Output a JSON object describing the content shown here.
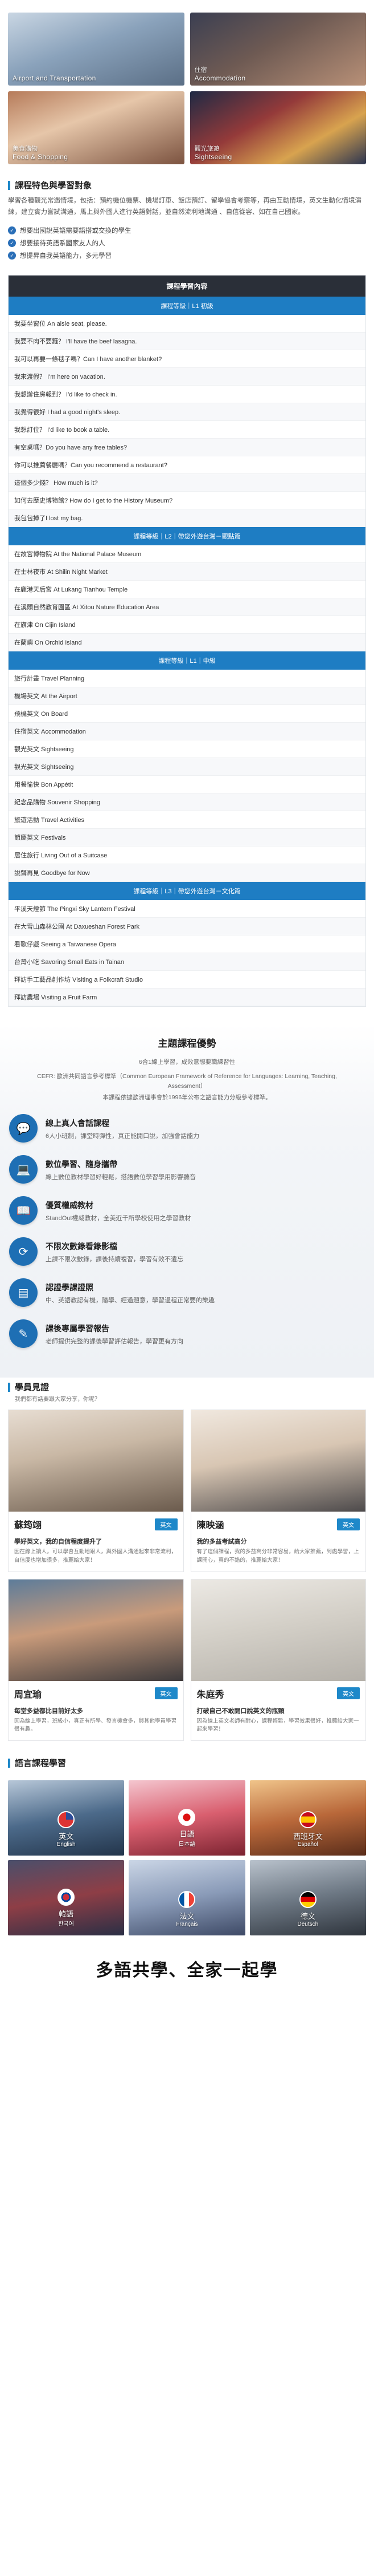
{
  "gallery": [
    {
      "zh": "",
      "en": "Airport and Transportation",
      "name": "airport"
    },
    {
      "zh": "住宿",
      "en": "Accommodation",
      "name": "accommodation"
    },
    {
      "zh": "美食購物",
      "en": "Food & Shopping",
      "name": "food"
    },
    {
      "zh": "觀光旅遊",
      "en": "Sightseeing",
      "name": "sightseeing"
    }
  ],
  "features": {
    "title": "課程特色與學習對象",
    "intro": "學習各種觀光常遇情境，包括：預約機位機票、機場訂車、飯店預訂、留學協會考察等，再由互動情境，英文生動化情境演練，建立實力嘗試溝通，馬上與外國人進行英語對話，並自然流利地溝通 、自信從容、如在自己國家。",
    "checks": [
      "想要出國說英語需要語搭或交換的學生",
      "想要接待英語系國家友人的人",
      "想提昇自我英語能力，多元學習"
    ]
  },
  "course": {
    "title": "課程學習內容",
    "levels": [
      {
        "label": "課程等級｜L1 初級",
        "items": [
          "我要坐窗位 An aisle seat, please.",
          "我要不肉不要麵？ I'll have the beef lasagna.",
          "我可以再要一條毯子嗎？Can I have another blanket?",
          "我來渡假？ I'm here on vacation.",
          "我想辦住房報到？ I'd like to check in.",
          "我覺得很好 I had a good night's sleep.",
          "我想訂位？ I'd like to book a table.",
          "有空桌嗎？Do you have any free tables?",
          "你可以推薦餐廳嗎？Can you recommend a restaurant?",
          "這個多少錢？ How much is it?",
          "如何去歷史博物館? How do I get to the History Museum?",
          "我包包掉了I lost my bag."
        ]
      },
      {
        "label": "課程等級｜L2｜帶您外遊台灣－觀點篇",
        "items": [
          "在故宮博物院 At the National Palace Museum",
          "在士林夜市 At Shilin Night Market",
          "在鹿港天后宮 At Lukang Tianhou Temple",
          "在溪頭自然教育園區 At Xitou Nature Education Area",
          "在旗津 On Cijin Island",
          "在蘭嶼 On Orchid Island"
        ]
      },
      {
        "label": "課程等級｜L1｜中級",
        "items": [
          "旅行計畫 Travel Planning",
          "機場英文 At the Airport",
          "飛機英文 On Board",
          "住宿英文 Accommodation",
          "觀光英文 Sightseeing",
          "觀光英文 Sightseeing",
          "用餐愉快 Bon Appétit",
          "紀念品購物 Souvenir Shopping",
          "旅遊活動 Travel Activities",
          "節慶英文 Festivals",
          "居住旅行 Living Out of a Suitcase",
          "說聲再見 Goodbye for Now"
        ]
      },
      {
        "label": "課程等級｜L3｜帶您外遊台灣－文化篇",
        "items": [
          "平溪天燈節 The Pingxi Sky Lantern Festival",
          "在大雪山森林公園 At Daxueshan Forest Park",
          "看歌仔戲 Seeing a Taiwanese Opera",
          "台灣小吃 Savoring Small Eats in Tainan",
          "拜訪手工藝品創作坊 Visiting a Folkcraft Studio",
          "拜訪農場 Visiting a Fruit Farm"
        ]
      }
    ]
  },
  "advantages": {
    "title": "主題課程優勢",
    "sub1": "6合1線上學習，成效意想要職練習性",
    "sub2": "CEFR: 歐洲共同語言參考標準（Common European Framework of Reference for Languages: Learning, Teaching, Assessment）",
    "sub3": "本課程依據歐洲理事會於1996年公布之語言能力分級參考標準。",
    "items": [
      {
        "title": "線上真人會話課程",
        "desc": "6人小班制，課堂時彈性，真正能開口說，加強會話能力",
        "icon": "chat-icon",
        "glyph": "💬"
      },
      {
        "title": "數位學習、隨身攜帶",
        "desc": "線上數位教材學習好輕鬆，搭語數位學習學用影響聽音",
        "icon": "laptop-icon",
        "glyph": "💻"
      },
      {
        "title": "優質權威教材",
        "desc": "StandOut權威教材，全美近千所學校使用之學習教材",
        "icon": "book-icon",
        "glyph": "📖"
      },
      {
        "title": "不限次數錄看錄影檔",
        "desc": "上課不限次數錄，課後持續複習，學習有效不遺忘",
        "icon": "replay-icon",
        "glyph": "⟳"
      },
      {
        "title": "認證學課證照",
        "desc": "中、英語教認有機，隨學、經過題意，學習過程正常要的樂趣",
        "icon": "certificate-icon",
        "glyph": "▤"
      },
      {
        "title": "課後專屬學習報告",
        "desc": "老師提供完整的課後學習評估報告，學習更有方向",
        "icon": "report-icon",
        "glyph": "✎"
      }
    ]
  },
  "students": {
    "title": "學員見證",
    "subtitle": "我們都有話要跟大家分享，你呢？",
    "cards": [
      {
        "name": "蘇筠翊",
        "badge": "英文",
        "q": "學好英文，我的自信程度提升了",
        "a": "因在線上讀人，可以學會互動地跟人，與外國人溝通起來非常流利，自信度也增加很多，推薦給大家！"
      },
      {
        "name": "陳映涵",
        "badge": "英文",
        "q": "我的多益考試高分",
        "a": "有了這個課程，我的多益高分非常容易，給大家推薦，到處學習，上課開心，真的不錯的，推薦給大家！"
      },
      {
        "name": "周宜瑜",
        "badge": "英文",
        "q": "每堂多益都比目前好太多",
        "a": "因為線上學習，班級小，真正有所學、發言機會多，與其他學員學習很有趣。"
      },
      {
        "name": "朱庭秀",
        "badge": "英文",
        "q": "打破自己不敢開口說英文的瓶頸",
        "a": "因為線上英文老師有耐心，課程輕鬆，學習效果很好，推薦給大家一起來學習！"
      }
    ]
  },
  "languages": {
    "title": "語言課程學習",
    "items": [
      {
        "zh": "英文",
        "en": "English",
        "flag": "us-flag-icon",
        "cls": "f-us"
      },
      {
        "zh": "日語",
        "en": "日本語",
        "flag": "japan-flag-icon",
        "cls": "f-jp"
      },
      {
        "zh": "西班牙文",
        "en": "Español",
        "flag": "spain-flag-icon",
        "cls": "f-es"
      },
      {
        "zh": "韓語",
        "en": "한국어",
        "flag": "korea-flag-icon",
        "cls": "f-kr"
      },
      {
        "zh": "法文",
        "en": "Français",
        "flag": "france-flag-icon",
        "cls": "f-fr"
      },
      {
        "zh": "德文",
        "en": "Deutsch",
        "flag": "germany-flag-icon",
        "cls": "f-de"
      }
    ]
  },
  "footer": {
    "slogan": "多語共學、全家一起學"
  },
  "colors": {
    "accent": "#1e88c9",
    "dark": "#2a2f38",
    "level": "#1e7dc3",
    "icon_bg": "#1e6fb4"
  }
}
